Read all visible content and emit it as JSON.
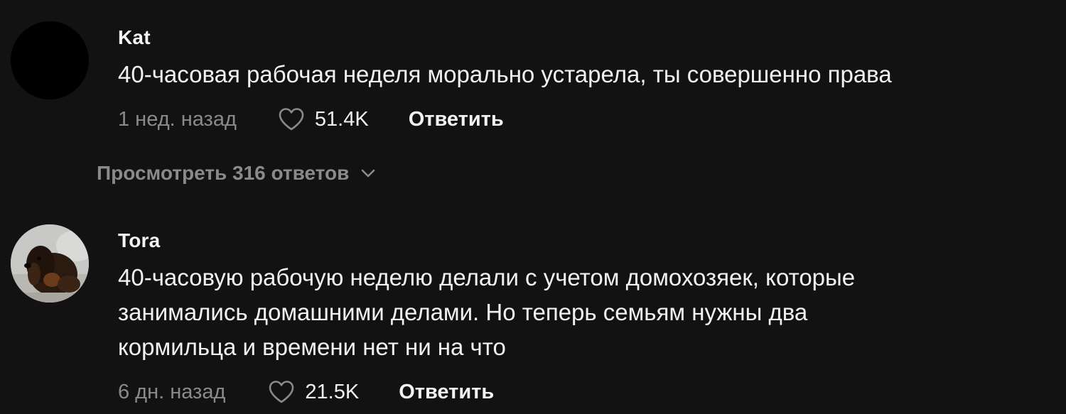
{
  "comments": [
    {
      "username": "Kat",
      "avatar": "black-avatar",
      "text_lines": [
        "40-часовая рабочая неделя морально устарела, ты совершенно права"
      ],
      "time": "1 нед. назад",
      "likes": "51.4K",
      "reply_label": "Ответить",
      "view_replies_label": "Просмотреть 316 ответов"
    },
    {
      "username": "Tora",
      "avatar": "dog-photo-avatar",
      "text_lines": [
        "40-часовую рабочую неделю делали с учетом домохозяек, которые",
        "занимались домашними делами. Но теперь семьям нужны два",
        "кормильца и времени нет ни на что"
      ],
      "time": "6 дн. назад",
      "likes": "21.5K",
      "reply_label": "Ответить"
    }
  ],
  "icons": {
    "like": "heart-outline-icon",
    "expand": "chevron-down-icon"
  },
  "colors": {
    "background": "#121212",
    "primary_text": "#f2f2f2",
    "secondary_text": "#8a8a8a"
  }
}
